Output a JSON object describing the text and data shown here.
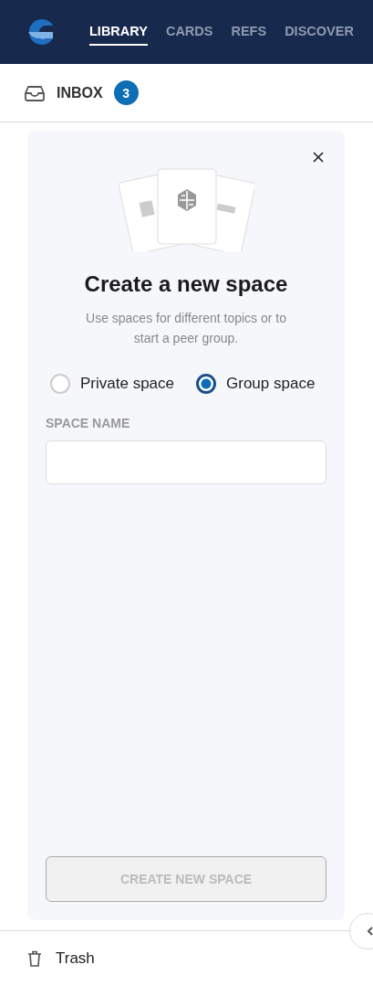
{
  "nav": {
    "tabs": [
      {
        "label": "LIBRARY",
        "selected": true
      },
      {
        "label": "CARDS",
        "selected": false
      },
      {
        "label": "REFS",
        "selected": false
      },
      {
        "label": "DISCOVER",
        "selected": false
      }
    ]
  },
  "inbox": {
    "label": "INBOX",
    "count": "3"
  },
  "dialog": {
    "title": "Create a new space",
    "description": "Use spaces for different topics or to start a peer group.",
    "options": [
      {
        "label": "Private space",
        "selected": false
      },
      {
        "label": "Group space",
        "selected": true
      }
    ],
    "field_label": "SPACE NAME",
    "submit": {
      "label": "CREATE NEW SPACE",
      "disabled": true
    }
  },
  "footer": {
    "label": "Trash"
  }
}
